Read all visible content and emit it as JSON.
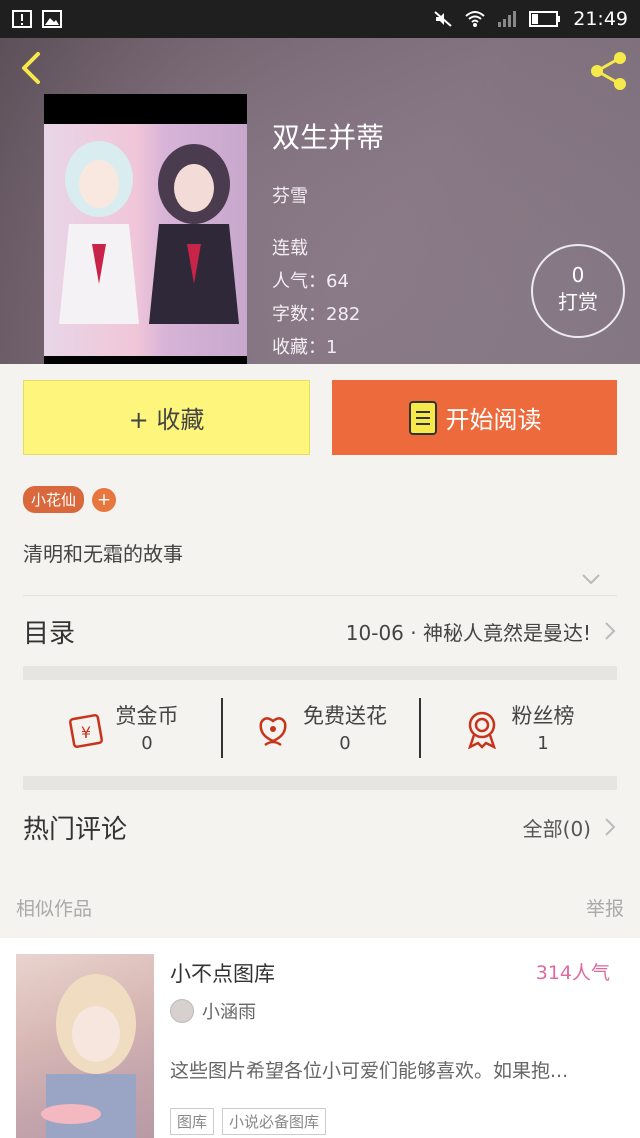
{
  "status_bar": {
    "time": "21:49"
  },
  "book": {
    "title": "双生并蒂",
    "author": "芬雪",
    "status": "连载",
    "popularity": "人气：64",
    "word_count": "字数：282",
    "favorites": "收藏：1",
    "reward_count": "0",
    "reward_label": "打赏"
  },
  "actions": {
    "favorite_label": "+ 收藏",
    "read_label": "开始阅读"
  },
  "tags": {
    "items": [
      "小花仙"
    ],
    "add_label": "+"
  },
  "description": "清明和无霜的故事",
  "catalog": {
    "label": "目录",
    "latest": "10-06 · 神秘人竟然是曼达!"
  },
  "stats": [
    {
      "name": "赏金币",
      "value": "0",
      "icon": "coin-icon"
    },
    {
      "name": "免费送花",
      "value": "0",
      "icon": "flower-icon"
    },
    {
      "name": "粉丝榜",
      "value": "1",
      "icon": "medal-icon"
    }
  ],
  "comments": {
    "label": "热门评论",
    "all": "全部(0)"
  },
  "similar": {
    "header": "相似作品",
    "report": "举报",
    "items": [
      {
        "title": "小不点图库",
        "popularity": "314人气",
        "author": "小涵雨",
        "summary": "这些图片希望各位小可爱们能够喜欢。如果抱...",
        "tags": [
          "图库",
          "小说必备图库"
        ]
      }
    ]
  },
  "colors": {
    "accent_orange": "#ec6a3c",
    "fav_yellow": "#fdf57c",
    "tag_orange": "#d9683d",
    "pop_pink": "#e06aa0"
  }
}
